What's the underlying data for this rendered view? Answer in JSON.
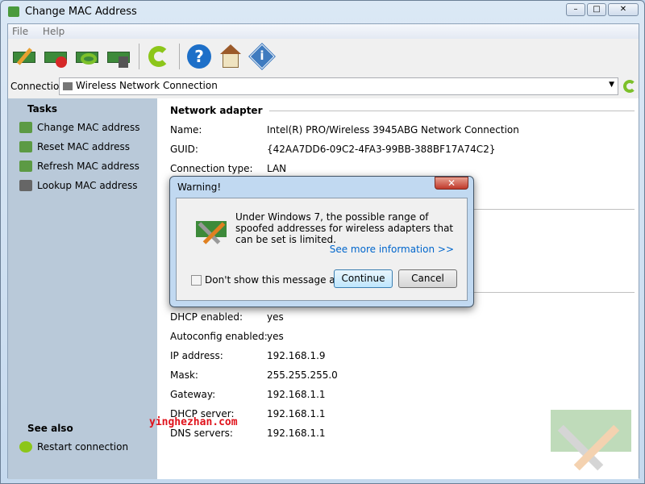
{
  "window": {
    "title": "Change MAC Address",
    "min": "–",
    "max": "□",
    "close": "✕"
  },
  "menu": [
    "File",
    "Help"
  ],
  "toolbar": [
    "change-mac-icon",
    "reset-mac-icon",
    "refresh-mac-icon",
    "lookup-mac-icon",
    "refresh-icon",
    "help-icon",
    "home-icon",
    "info-icon"
  ],
  "connection": {
    "label": "Connection:",
    "value": "Wireless Network Connection"
  },
  "tasks": {
    "title": "Tasks",
    "items": [
      "Change MAC address",
      "Reset MAC address",
      "Refresh MAC address",
      "Lookup MAC address"
    ]
  },
  "see_also": {
    "title": "See also",
    "items": [
      "Restart connection"
    ]
  },
  "adapter": {
    "title": "Network adapter",
    "rows": [
      {
        "k": "Name:",
        "v": "Intel(R) PRO/Wireless 3945ABG Network Connection"
      },
      {
        "k": "GUID:",
        "v": "{42AA7DD6-09C2-4FA3-99BB-388BF17A74C2}"
      },
      {
        "k": "Connection type:",
        "v": "LAN"
      }
    ]
  },
  "ip": {
    "rows": [
      {
        "k": "DHCP enabled:",
        "v": "yes"
      },
      {
        "k": "Autoconfig enabled:",
        "v": "yes"
      },
      {
        "k": "IP address:",
        "v": "192.168.1.9"
      },
      {
        "k": "Mask:",
        "v": "255.255.255.0"
      },
      {
        "k": "Gateway:",
        "v": "192.168.1.1"
      },
      {
        "k": "DHCP server:",
        "v": "192.168.1.1"
      },
      {
        "k": "DNS servers:",
        "v": "192.168.1.1"
      }
    ]
  },
  "watermark": "yinghezhan.com",
  "dialog": {
    "title": "Warning!",
    "message": "Under Windows 7, the possible range of spoofed addresses for wireless adapters that can be set is limited.",
    "link": "See more information >>",
    "checkbox": "Don't show this message again",
    "continue": "Continue",
    "cancel": "Cancel"
  }
}
